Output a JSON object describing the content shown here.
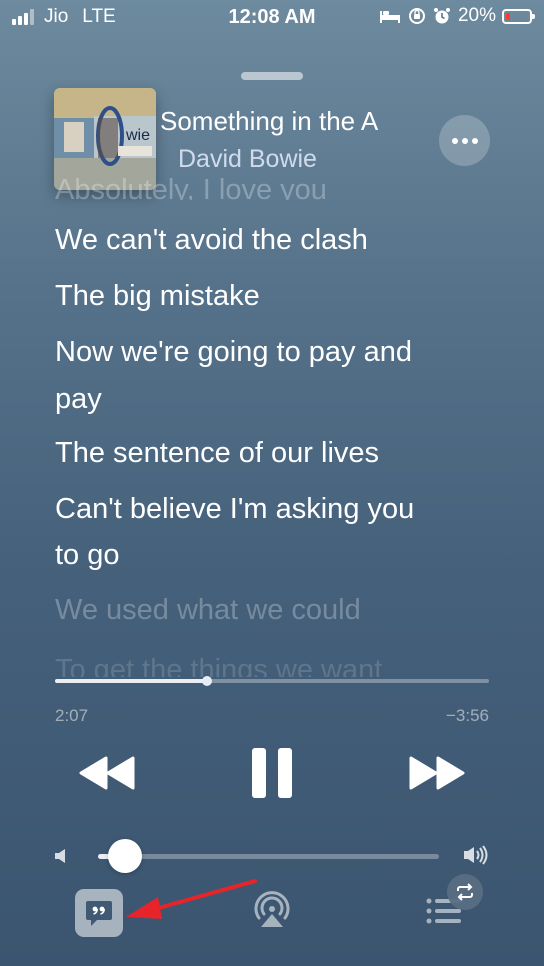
{
  "status_bar": {
    "carrier": "Jio",
    "network": "LTE",
    "time": "12:08 AM",
    "battery_percent": "20%",
    "battery_level": 0.2,
    "battery_color": "#ff3b30",
    "signal_bars_active": 3,
    "icons": [
      "bed-icon",
      "orientation-lock-icon",
      "alarm-clock-icon"
    ]
  },
  "now_playing": {
    "title": "Something in the A",
    "artist": "David Bowie",
    "more_icon": "ellipsis-icon"
  },
  "lyrics": {
    "previous_partial": "Absolutely, I love you",
    "lines": [
      "We can't avoid the clash",
      "The big mistake",
      "Now we're going to pay and",
      "pay",
      "The sentence of our lives",
      "Can't believe I'm asking you",
      "to go"
    ],
    "upcoming": [
      "We used what we could",
      "To get the things we want"
    ]
  },
  "playback": {
    "elapsed": "2:07",
    "remaining": "−3:56",
    "progress": 0.35,
    "state": "playing"
  },
  "volume": {
    "level": 0.04
  },
  "accent_colors": {
    "annotation_arrow": "#e8242b"
  }
}
